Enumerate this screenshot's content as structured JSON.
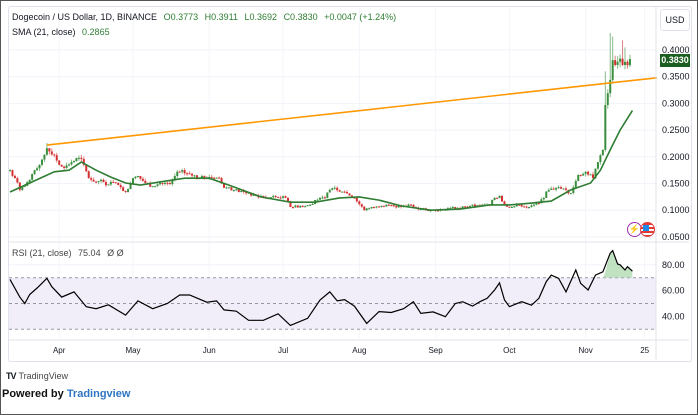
{
  "header": {
    "symbol": "Dogecoin / US Dollar, 1D, BINANCE",
    "open": "O0.3773",
    "high": "H0.3911",
    "low": "L0.3692",
    "close": "C0.3830",
    "change": "+0.0047 (+1.24%)",
    "sma_label": "SMA (21, close)",
    "sma_value": "0.2865",
    "rsi_label": "RSI (21, close)",
    "rsi_value": "75.04",
    "rsi_extra": "Ø Ø"
  },
  "axis": {
    "currency": "USD",
    "last_price": "0.3830"
  },
  "footer": {
    "logo_text": "TradingView",
    "powered_prefix": "Powered by",
    "powered_link": "Tradingview"
  },
  "icons": [
    "lightning-icon",
    "us-flag-icon"
  ],
  "colors": {
    "up": "#388e3c",
    "down": "#d32f2f",
    "sma": "#2e7d32",
    "trend": "#ff9800",
    "rsi": "#000000",
    "rsi_band": "#f1eefa",
    "rsi_fill": "#a5d6a7"
  },
  "chart_data": [
    {
      "type": "candlestick",
      "title": "Dogecoin / US Dollar, 1D, BINANCE",
      "x_unit": "days since Mar 12",
      "ylim": [
        0.05,
        0.44
      ],
      "yticks": [
        "0.4000",
        "0.3500",
        "0.3000",
        "0.2500",
        "0.2000",
        "0.1500",
        "0.1000",
        "0.0500"
      ],
      "ytick_values": [
        0.4,
        0.35,
        0.3,
        0.25,
        0.2,
        0.15,
        0.1,
        0.05
      ],
      "xticks": [
        {
          "label": "Apr",
          "day": 20
        },
        {
          "label": "May",
          "day": 50
        },
        {
          "label": "Jun",
          "day": 81
        },
        {
          "label": "Jul",
          "day": 111
        },
        {
          "label": "Aug",
          "day": 142
        },
        {
          "label": "Sep",
          "day": 173
        },
        {
          "label": "Oct",
          "day": 203
        },
        {
          "label": "Nov",
          "day": 234
        },
        {
          "label": "25",
          "day": 258
        }
      ],
      "closes": [
        [
          0,
          0.175
        ],
        [
          2,
          0.16
        ],
        [
          4,
          0.138
        ],
        [
          8,
          0.157
        ],
        [
          12,
          0.185
        ],
        [
          15,
          0.216
        ],
        [
          18,
          0.203
        ],
        [
          20,
          0.185
        ],
        [
          22,
          0.179
        ],
        [
          25,
          0.19
        ],
        [
          28,
          0.198
        ],
        [
          30,
          0.185
        ],
        [
          32,
          0.16
        ],
        [
          35,
          0.153
        ],
        [
          37,
          0.157
        ],
        [
          39,
          0.147
        ],
        [
          41,
          0.153
        ],
        [
          44,
          0.147
        ],
        [
          47,
          0.134
        ],
        [
          50,
          0.16
        ],
        [
          52,
          0.164
        ],
        [
          55,
          0.151
        ],
        [
          58,
          0.145
        ],
        [
          61,
          0.151
        ],
        [
          65,
          0.149
        ],
        [
          67,
          0.164
        ],
        [
          69,
          0.172
        ],
        [
          73,
          0.168
        ],
        [
          77,
          0.16
        ],
        [
          81,
          0.162
        ],
        [
          85,
          0.16
        ],
        [
          87,
          0.142
        ],
        [
          91,
          0.138
        ],
        [
          96,
          0.132
        ],
        [
          100,
          0.127
        ],
        [
          104,
          0.123
        ],
        [
          108,
          0.125
        ],
        [
          112,
          0.123
        ],
        [
          114,
          0.106
        ],
        [
          118,
          0.108
        ],
        [
          122,
          0.11
        ],
        [
          124,
          0.119
        ],
        [
          128,
          0.123
        ],
        [
          130,
          0.138
        ],
        [
          132,
          0.142
        ],
        [
          136,
          0.134
        ],
        [
          140,
          0.123
        ],
        [
          144,
          0.1
        ],
        [
          147,
          0.106
        ],
        [
          150,
          0.106
        ],
        [
          154,
          0.11
        ],
        [
          159,
          0.106
        ],
        [
          163,
          0.11
        ],
        [
          167,
          0.102
        ],
        [
          171,
          0.1
        ],
        [
          175,
          0.102
        ],
        [
          179,
          0.104
        ],
        [
          183,
          0.104
        ],
        [
          187,
          0.108
        ],
        [
          191,
          0.108
        ],
        [
          195,
          0.11
        ],
        [
          197,
          0.123
        ],
        [
          199,
          0.127
        ],
        [
          201,
          0.11
        ],
        [
          204,
          0.106
        ],
        [
          207,
          0.11
        ],
        [
          211,
          0.106
        ],
        [
          215,
          0.113
        ],
        [
          219,
          0.138
        ],
        [
          222,
          0.142
        ],
        [
          226,
          0.138
        ],
        [
          228,
          0.132
        ],
        [
          231,
          0.166
        ],
        [
          234,
          0.172
        ],
        [
          237,
          0.16
        ],
        [
          239,
          0.19
        ],
        [
          241,
          0.213
        ],
        [
          242,
          0.297
        ],
        [
          244,
          0.344
        ],
        [
          245,
          0.381
        ],
        [
          247,
          0.378
        ],
        [
          249,
          0.372
        ],
        [
          250,
          0.378
        ],
        [
          252,
          0.383
        ]
      ],
      "high_overrides": [
        [
          15,
          0.226
        ],
        [
          242,
          0.36
        ],
        [
          244,
          0.432
        ],
        [
          245,
          0.425
        ],
        [
          249,
          0.418
        ],
        [
          250,
          0.405
        ],
        [
          252,
          0.3911
        ]
      ],
      "series": [
        {
          "name": "SMA (21, close)",
          "points": [
            [
              0,
              0.134
            ],
            [
              8,
              0.151
            ],
            [
              18,
              0.172
            ],
            [
              24,
              0.175
            ],
            [
              29,
              0.19
            ],
            [
              35,
              0.175
            ],
            [
              41,
              0.162
            ],
            [
              47,
              0.151
            ],
            [
              53,
              0.147
            ],
            [
              61,
              0.153
            ],
            [
              71,
              0.16
            ],
            [
              81,
              0.16
            ],
            [
              89,
              0.147
            ],
            [
              102,
              0.125
            ],
            [
              114,
              0.115
            ],
            [
              124,
              0.115
            ],
            [
              134,
              0.123
            ],
            [
              142,
              0.125
            ],
            [
              150,
              0.119
            ],
            [
              159,
              0.108
            ],
            [
              171,
              0.1
            ],
            [
              183,
              0.102
            ],
            [
              195,
              0.11
            ],
            [
              203,
              0.11
            ],
            [
              211,
              0.113
            ],
            [
              220,
              0.117
            ],
            [
              228,
              0.138
            ],
            [
              236,
              0.151
            ],
            [
              240,
              0.175
            ],
            [
              244,
              0.213
            ],
            [
              248,
              0.25
            ],
            [
              253,
              0.2865
            ]
          ]
        },
        {
          "name": "Trendline",
          "points": [
            [
              15,
              0.222
            ],
            [
              263,
              0.348
            ]
          ]
        }
      ]
    },
    {
      "type": "line",
      "title": "RSI (21, close)",
      "ylim": [
        25,
        95
      ],
      "yticks": [
        "80.00",
        "60.00",
        "40.00"
      ],
      "ytick_values": [
        80,
        60,
        40
      ],
      "bands": [
        70,
        50,
        30
      ],
      "points": [
        [
          0,
          68.7
        ],
        [
          4,
          55
        ],
        [
          6,
          50
        ],
        [
          8,
          57
        ],
        [
          11,
          62
        ],
        [
          15,
          69.5
        ],
        [
          17,
          63
        ],
        [
          21,
          55
        ],
        [
          26,
          59
        ],
        [
          31,
          47.5
        ],
        [
          35,
          46
        ],
        [
          40,
          49
        ],
        [
          47,
          41
        ],
        [
          52,
          52
        ],
        [
          58,
          46
        ],
        [
          64,
          50
        ],
        [
          69,
          56.6
        ],
        [
          73,
          56.6
        ],
        [
          80,
          51
        ],
        [
          84,
          52
        ],
        [
          87,
          45
        ],
        [
          92,
          44
        ],
        [
          97,
          37
        ],
        [
          103,
          37
        ],
        [
          109,
          42
        ],
        [
          114,
          33
        ],
        [
          121,
          38.5
        ],
        [
          126,
          52.7
        ],
        [
          130,
          59
        ],
        [
          133,
          52
        ],
        [
          136,
          53
        ],
        [
          140,
          48
        ],
        [
          145,
          34.6
        ],
        [
          150,
          43.7
        ],
        [
          155,
          43
        ],
        [
          160,
          46
        ],
        [
          164,
          51.4
        ],
        [
          167,
          42.4
        ],
        [
          172,
          43.5
        ],
        [
          177,
          39.8
        ],
        [
          181,
          50
        ],
        [
          184,
          51.4
        ],
        [
          188,
          48
        ],
        [
          191,
          51.4
        ],
        [
          194,
          54
        ],
        [
          197,
          60.5
        ],
        [
          199,
          66
        ],
        [
          201,
          52.7
        ],
        [
          203,
          47.5
        ],
        [
          208,
          51.4
        ],
        [
          212,
          48.7
        ],
        [
          215,
          54
        ],
        [
          218,
          67
        ],
        [
          220,
          72
        ],
        [
          223,
          69.5
        ],
        [
          226,
          59
        ],
        [
          230,
          76
        ],
        [
          232,
          65.6
        ],
        [
          235,
          60.5
        ],
        [
          238,
          72
        ],
        [
          241,
          74.6
        ],
        [
          244,
          89
        ],
        [
          245,
          91
        ],
        [
          247,
          80.6
        ],
        [
          248,
          80
        ],
        [
          250,
          76
        ],
        [
          251,
          78.5
        ],
        [
          253,
          75.04
        ]
      ]
    }
  ]
}
